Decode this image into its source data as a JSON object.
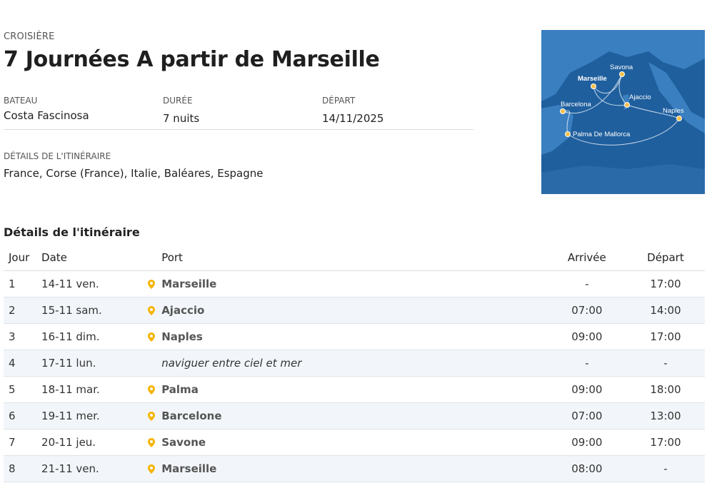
{
  "header": {
    "eyebrow": "CROISIÈRE",
    "title": "7 Journées A partir de Marseille"
  },
  "meta": {
    "ship_label": "BATEAU",
    "ship_value": "Costa Fascinosa",
    "duration_label": "DURÉE",
    "duration_value": "7 nuits",
    "departure_label": "DÉPART",
    "departure_value": "14/11/2025"
  },
  "itinerary_summary": {
    "label": "DÉTAILS DE L'ITINÉRAIRE",
    "value": "France, Corse (France), Italie, Baléares, Espagne"
  },
  "map": {
    "labels": {
      "savona": "Savona",
      "marseille": "Marseille",
      "ajaccio": "Ajaccio",
      "barcelona": "Barcelona",
      "naples": "Naples",
      "palma": "Palma De Mallorca"
    },
    "colors": {
      "sea": "#1f5f9e",
      "land": "#2e76b8",
      "route": "#e6eef7",
      "port": "#f4c04a"
    }
  },
  "table": {
    "title": "Détails de l'itinéraire",
    "headers": {
      "day": "Jour",
      "date": "Date",
      "port": "Port",
      "arrival": "Arrivée",
      "departure": "Départ"
    },
    "rows": [
      {
        "day": "1",
        "date": "14-11 ven.",
        "port": "Marseille",
        "arrival": "-",
        "departure": "17:00"
      },
      {
        "day": "2",
        "date": "15-11 sam.",
        "port": "Ajaccio",
        "arrival": "07:00",
        "departure": "14:00"
      },
      {
        "day": "3",
        "date": "16-11 dim.",
        "port": "Naples",
        "arrival": "09:00",
        "departure": "17:00"
      },
      {
        "day": "4",
        "date": "17-11 lun.",
        "port": "naviguer entre ciel et mer",
        "arrival": "-",
        "departure": "-"
      },
      {
        "day": "5",
        "date": "18-11 mar.",
        "port": "Palma",
        "arrival": "09:00",
        "departure": "18:00"
      },
      {
        "day": "6",
        "date": "19-11 mer.",
        "port": "Barcelone",
        "arrival": "07:00",
        "departure": "13:00"
      },
      {
        "day": "7",
        "date": "20-11 jeu.",
        "port": "Savone",
        "arrival": "09:00",
        "departure": "17:00"
      },
      {
        "day": "8",
        "date": "21-11 ven.",
        "port": "Marseille",
        "arrival": "08:00",
        "departure": "-"
      }
    ]
  },
  "colors": {
    "pin": "#f5b400",
    "row_alt": "#f2f6fa"
  }
}
